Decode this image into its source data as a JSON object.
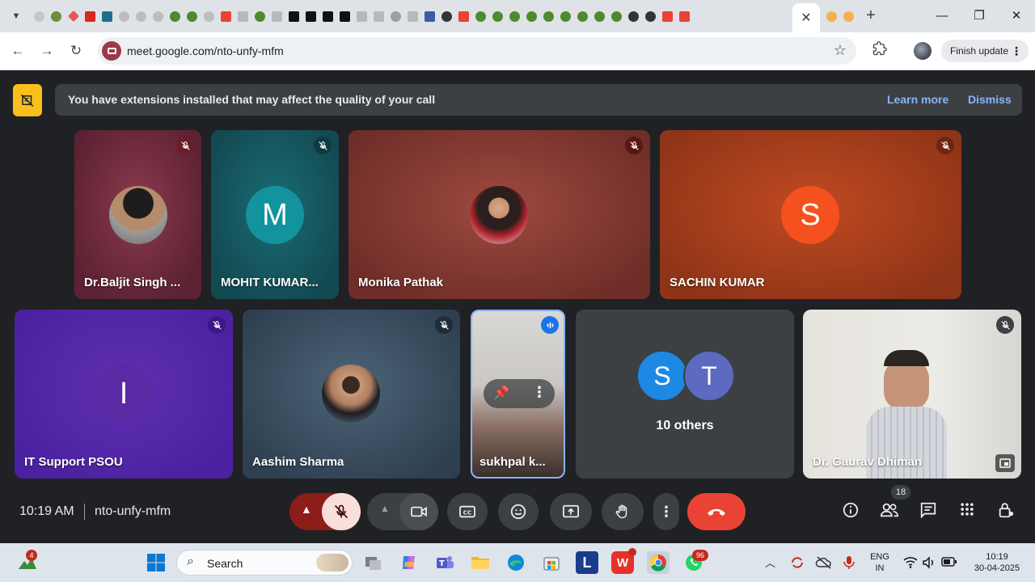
{
  "browser": {
    "url": "meet.google.com/nto-unfy-mfm",
    "finish_update_label": "Finish update",
    "close_tab_glyph": "✕",
    "new_tab_glyph": "+",
    "window_minimize": "—",
    "window_restore": "❐",
    "window_close": "✕"
  },
  "banner": {
    "text": "You have extensions installed that may affect the quality of your call",
    "learn_more": "Learn more",
    "dismiss": "Dismiss"
  },
  "participants": [
    {
      "name": "Dr.Baljit Singh ...",
      "muted": true
    },
    {
      "name": "MOHIT KUMAR...",
      "initial": "M",
      "muted": true
    },
    {
      "name": "Monika Pathak",
      "muted": true
    },
    {
      "name": "SACHIN KUMAR",
      "initial": "S",
      "muted": true
    },
    {
      "name": "IT Support PSOU",
      "initial": "I",
      "muted": true
    },
    {
      "name": "Aashim Sharma",
      "muted": true
    },
    {
      "name": "sukhpal k...",
      "speaking": true
    },
    {
      "others_label": "10 others",
      "initials": [
        "S",
        "T"
      ]
    },
    {
      "name": "Dr. Gaurav Dhiman",
      "muted": true
    }
  ],
  "meeting": {
    "time": "10:19 AM",
    "code": "nto-unfy-mfm",
    "people_count": "18"
  },
  "taskbar": {
    "search_placeholder": "Search",
    "widgets_badge": "4",
    "whatsapp_badge": "96",
    "lang_top": "ENG",
    "lang_bottom": "IN",
    "clock_time": "10:19",
    "clock_date": "30-04-2025"
  },
  "colors": {
    "accent_blue": "#8ab4f8",
    "end_call_red": "#ea4335",
    "banner_bg": "#3c4043",
    "extension_badge": "#f9bf1b"
  }
}
